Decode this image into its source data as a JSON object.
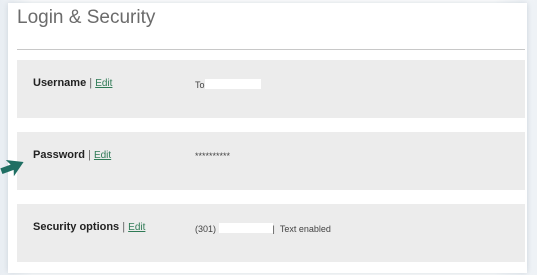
{
  "page": {
    "title": "Login & Security"
  },
  "rows": [
    {
      "label": "Username",
      "separator": " | ",
      "edit_label": "Edit",
      "value_prefix": "To",
      "value_suffix": ""
    },
    {
      "label": "Password",
      "separator": " | ",
      "edit_label": "Edit",
      "value": "**********"
    },
    {
      "label": "Security options",
      "separator": " | ",
      "edit_label": "Edit",
      "phone_prefix": "(301) ",
      "phone_suffix": "|",
      "status": "Text enabled"
    }
  ],
  "colors": {
    "link": "#2e7a55",
    "arrow": "#1f6f63",
    "row_background": "#ececec"
  },
  "icons": {
    "pointer_arrow": "arrow-right-icon"
  }
}
